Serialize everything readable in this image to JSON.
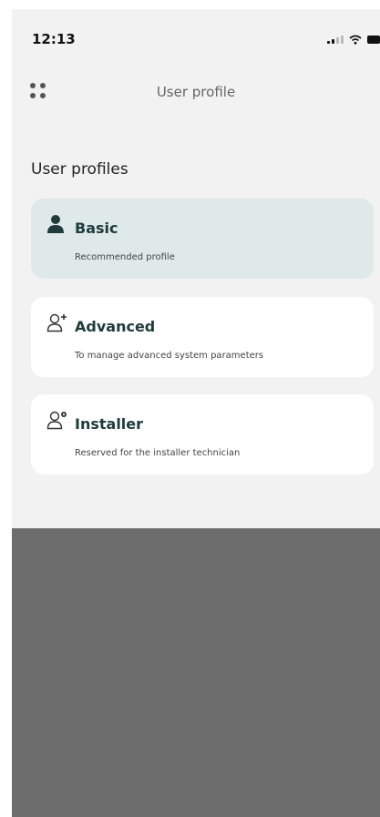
{
  "status_bar": {
    "time": "12:13",
    "icons": [
      "signal-icon",
      "wifi-icon",
      "battery-icon"
    ]
  },
  "header": {
    "title": "User profile",
    "menu_icon": "grid-dots-icon"
  },
  "section": {
    "title": "User profiles"
  },
  "profiles": [
    {
      "title": "Basic",
      "subtitle": "Recommended profile",
      "icon": "person-filled-icon",
      "selected": true
    },
    {
      "title": "Advanced",
      "subtitle": "To manage advanced system parameters",
      "icon": "person-plus-icon",
      "selected": false
    },
    {
      "title": "Installer",
      "subtitle": "Reserved for the installer technician",
      "icon": "person-gear-icon",
      "selected": false
    }
  ],
  "colors": {
    "background": "#f2f2f2",
    "selected_card": "#dfe9e9",
    "card": "#ffffff",
    "title_text": "#1f3b3b",
    "overlay": "#6d6d6d"
  }
}
